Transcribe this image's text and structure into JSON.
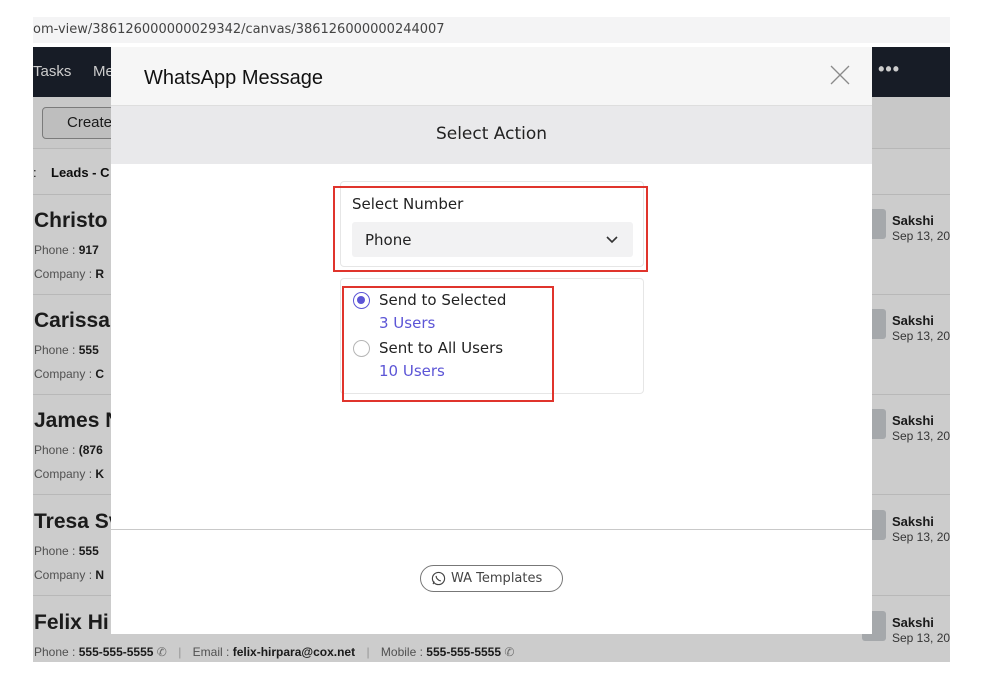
{
  "browser": {
    "url": "om-view/386126000000029342/canvas/386126000000244007"
  },
  "app": {
    "nav": {
      "item1": "Tasks",
      "item2": "Me",
      "more": "•••"
    },
    "toolbar": {
      "create_label": "Create"
    },
    "breadcrumb": {
      "separator": ":",
      "view": "Leads - C"
    },
    "leads": [
      {
        "name": "Christo",
        "phone_label": "Phone :",
        "phone": "917",
        "company_label": "Company :",
        "company": "R",
        "owner": "Sakshi",
        "date": "Sep 13, 20"
      },
      {
        "name": "Carissa",
        "phone_label": "Phone :",
        "phone": "555",
        "company_label": "Company :",
        "company": "C",
        "owner": "Sakshi",
        "date": "Sep 13, 20"
      },
      {
        "name": "James N",
        "phone_label": "Phone :",
        "phone": "(876",
        "company_label": "Company :",
        "company": "K",
        "owner": "Sakshi",
        "date": "Sep 13, 20"
      },
      {
        "name": "Tresa Sv",
        "phone_label": "Phone :",
        "phone": "555",
        "company_label": "Company :",
        "company": "N",
        "owner": "Sakshi",
        "date": "Sep 13, 20"
      },
      {
        "name": "Felix Hi",
        "phone_label": "Phone :",
        "phone": "555-555-5555",
        "email_label": "Email :",
        "email": "felix-hirpara@cox.net",
        "mobile_label": "Mobile :",
        "mobile": "555-555-5555",
        "owner": "Sakshi",
        "date": "Sep 13, 20"
      }
    ]
  },
  "modal": {
    "title": "WhatsApp Message",
    "section_title": "Select Action",
    "select_number": {
      "label": "Select Number",
      "value": "Phone"
    },
    "send_options": [
      {
        "label": "Send to Selected",
        "count": "3 Users",
        "selected": true
      },
      {
        "label": "Sent to All Users",
        "count": "10 Users",
        "selected": false
      }
    ],
    "footer": {
      "templates_button": "WA Templates"
    }
  },
  "colors": {
    "accent": "#5c55d6",
    "highlight": "#e0342c",
    "nav_bg": "#1d2330"
  },
  "icons": {
    "close": "close-icon",
    "chevron": "chevron-down-icon",
    "whatsapp": "whatsapp-icon",
    "call": "phone-call-icon"
  }
}
